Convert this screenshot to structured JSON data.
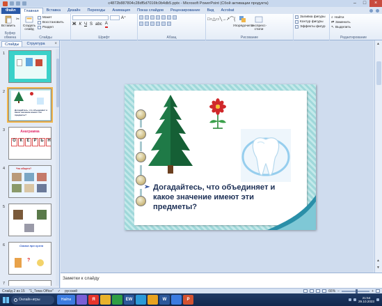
{
  "window": {
    "title": "c4872b887804c28df5d7016fc0b4db5.pptx - Microsoft PowerPoint (Сбой активации продукта)"
  },
  "ribbon": {
    "tabs": [
      "Файл",
      "Главная",
      "Вставка",
      "Дизайн",
      "Переходы",
      "Анимация",
      "Показ слайдов",
      "Рецензирование",
      "Вид",
      "Acrobat"
    ],
    "active_tab": "Главная",
    "clipboard": {
      "paste": "Вставить",
      "group": "Буфер обмена"
    },
    "slides": {
      "create": "Создать слайд",
      "layout": "Макет",
      "reset": "Восстановить",
      "section": "Раздел",
      "group": "Слайды"
    },
    "font": {
      "name": "",
      "size": "",
      "group": "Шрифт"
    },
    "paragraph": {
      "group": "Абзац"
    },
    "drawing": {
      "arrange": "Упорядочить",
      "quick_styles": "Экспресс-стили",
      "fill": "Заливка фигуры",
      "outline": "Контур фигуры",
      "effects": "Эффекты фигур",
      "group": "Рисование"
    },
    "editing": {
      "find": "Найти",
      "replace": "Заменить",
      "select": "Выделить",
      "group": "Редактирование"
    }
  },
  "panel": {
    "tabs": [
      "Слайды",
      "Структура"
    ],
    "active_tab": "Слайды",
    "close": "×",
    "thumbnails": [
      {
        "num": "1",
        "caption": ""
      },
      {
        "num": "2",
        "caption": "Догадайтесь, что объединяет и какое значение имеют эти предметы?"
      },
      {
        "num": "3",
        "caption": "Анаграмма",
        "letters": [
          "О",
          "К",
          "Е",
          "Р",
          "Ь",
          "Н"
        ]
      },
      {
        "num": "4",
        "caption": "Что общего?"
      },
      {
        "num": "5",
        "caption": ""
      },
      {
        "num": "6",
        "caption": "Сказка про кузна"
      },
      {
        "num": "7",
        "caption": ""
      }
    ],
    "selected": "2"
  },
  "slide": {
    "question": "Догадайтесь, что объединяет и какое значение имеют эти предметы?",
    "bullet": "➢"
  },
  "notes": {
    "placeholder": "Заметки к слайду"
  },
  "status": {
    "slide_counter": "Слайд 2 из 15",
    "theme": "\"1_Тема Office\"",
    "language": "русский",
    "zoom": "66%"
  },
  "taskbar": {
    "search": "Онлайн-игры",
    "apps": [
      {
        "label": "Найти",
        "color": "#3b7be0"
      },
      {
        "label": "",
        "color": "#7a5fd6"
      },
      {
        "label": "Я",
        "color": "#e5352b"
      },
      {
        "label": "",
        "color": "#e8b22c"
      },
      {
        "label": "",
        "color": "#2f9e44"
      },
      {
        "label": "EW",
        "color": "#2b579a"
      },
      {
        "label": "",
        "color": "#2a9ad8"
      },
      {
        "label": "",
        "color": "#e8a21f"
      },
      {
        "label": "W",
        "color": "#2b579a"
      },
      {
        "label": "",
        "color": "#3b7be0"
      },
      {
        "label": "P",
        "color": "#d35230"
      }
    ],
    "time": "21:54",
    "date": "29.10.2023"
  }
}
